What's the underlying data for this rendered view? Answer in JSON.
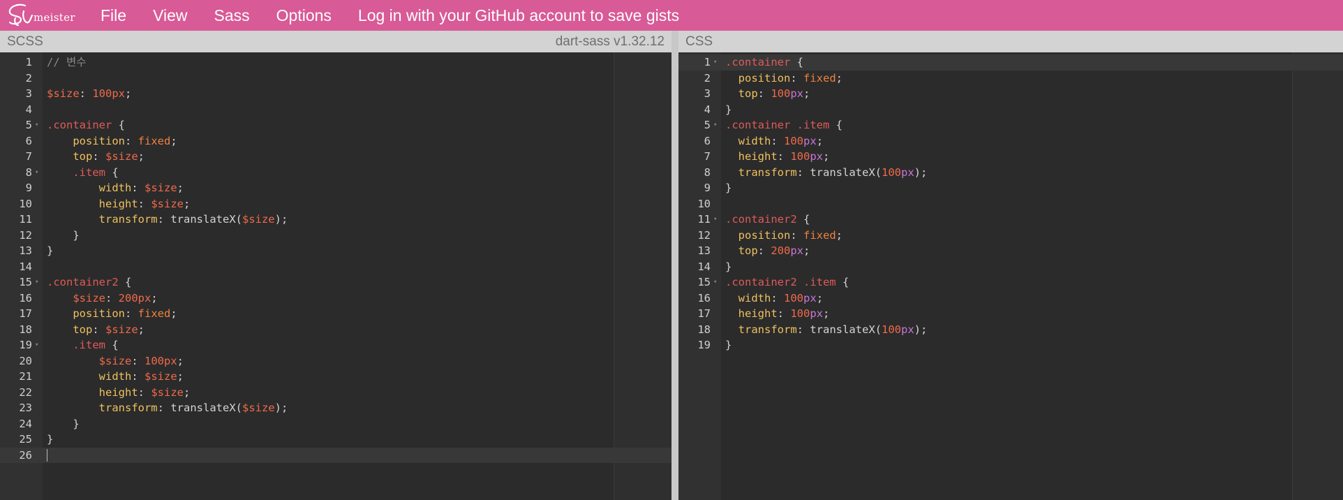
{
  "header": {
    "logo_text": "meister",
    "menu": [
      "File",
      "View",
      "Sass",
      "Options"
    ],
    "login_link": "Log in with your GitHub account to save gists"
  },
  "left_pane": {
    "title": "SCSS",
    "version": "dart-sass v1.32.12",
    "active_line": 26,
    "lines": [
      {
        "n": "1",
        "fold": false,
        "tokens": [
          {
            "t": "com",
            "v": "// 변수"
          }
        ]
      },
      {
        "n": "2",
        "fold": false,
        "tokens": []
      },
      {
        "n": "3",
        "fold": false,
        "tokens": [
          {
            "t": "var",
            "v": "$size"
          },
          {
            "t": "pun",
            "v": ": "
          },
          {
            "t": "num",
            "v": "100px"
          },
          {
            "t": "pun",
            "v": ";"
          }
        ]
      },
      {
        "n": "4",
        "fold": false,
        "tokens": []
      },
      {
        "n": "5",
        "fold": true,
        "tokens": [
          {
            "t": "sel",
            "v": ".container"
          },
          {
            "t": "pun",
            "v": " {"
          }
        ]
      },
      {
        "n": "6",
        "fold": false,
        "tokens": [
          {
            "t": "pun",
            "v": "    "
          },
          {
            "t": "prop",
            "v": "position"
          },
          {
            "t": "pun",
            "v": ": "
          },
          {
            "t": "val",
            "v": "fixed"
          },
          {
            "t": "pun",
            "v": ";"
          }
        ]
      },
      {
        "n": "7",
        "fold": false,
        "tokens": [
          {
            "t": "pun",
            "v": "    "
          },
          {
            "t": "prop",
            "v": "top"
          },
          {
            "t": "pun",
            "v": ": "
          },
          {
            "t": "var",
            "v": "$size"
          },
          {
            "t": "pun",
            "v": ";"
          }
        ]
      },
      {
        "n": "8",
        "fold": true,
        "tokens": [
          {
            "t": "pun",
            "v": "    "
          },
          {
            "t": "sel",
            "v": ".item"
          },
          {
            "t": "pun",
            "v": " {"
          }
        ]
      },
      {
        "n": "9",
        "fold": false,
        "tokens": [
          {
            "t": "pun",
            "v": "        "
          },
          {
            "t": "prop",
            "v": "width"
          },
          {
            "t": "pun",
            "v": ": "
          },
          {
            "t": "var",
            "v": "$size"
          },
          {
            "t": "pun",
            "v": ";"
          }
        ]
      },
      {
        "n": "10",
        "fold": false,
        "tokens": [
          {
            "t": "pun",
            "v": "        "
          },
          {
            "t": "prop",
            "v": "height"
          },
          {
            "t": "pun",
            "v": ": "
          },
          {
            "t": "var",
            "v": "$size"
          },
          {
            "t": "pun",
            "v": ";"
          }
        ]
      },
      {
        "n": "11",
        "fold": false,
        "tokens": [
          {
            "t": "pun",
            "v": "        "
          },
          {
            "t": "prop",
            "v": "transform"
          },
          {
            "t": "pun",
            "v": ": "
          },
          {
            "t": "fn",
            "v": "translateX("
          },
          {
            "t": "var",
            "v": "$size"
          },
          {
            "t": "pun",
            "v": ");"
          }
        ]
      },
      {
        "n": "12",
        "fold": false,
        "tokens": [
          {
            "t": "pun",
            "v": "    }"
          }
        ]
      },
      {
        "n": "13",
        "fold": false,
        "tokens": [
          {
            "t": "pun",
            "v": "}"
          }
        ]
      },
      {
        "n": "14",
        "fold": false,
        "tokens": []
      },
      {
        "n": "15",
        "fold": true,
        "tokens": [
          {
            "t": "sel",
            "v": ".container2"
          },
          {
            "t": "pun",
            "v": " {"
          }
        ]
      },
      {
        "n": "16",
        "fold": false,
        "tokens": [
          {
            "t": "pun",
            "v": "    "
          },
          {
            "t": "var",
            "v": "$size"
          },
          {
            "t": "pun",
            "v": ": "
          },
          {
            "t": "num",
            "v": "200px"
          },
          {
            "t": "pun",
            "v": ";"
          }
        ]
      },
      {
        "n": "17",
        "fold": false,
        "tokens": [
          {
            "t": "pun",
            "v": "    "
          },
          {
            "t": "prop",
            "v": "position"
          },
          {
            "t": "pun",
            "v": ": "
          },
          {
            "t": "val",
            "v": "fixed"
          },
          {
            "t": "pun",
            "v": ";"
          }
        ]
      },
      {
        "n": "18",
        "fold": false,
        "tokens": [
          {
            "t": "pun",
            "v": "    "
          },
          {
            "t": "prop",
            "v": "top"
          },
          {
            "t": "pun",
            "v": ": "
          },
          {
            "t": "var",
            "v": "$size"
          },
          {
            "t": "pun",
            "v": ";"
          }
        ]
      },
      {
        "n": "19",
        "fold": true,
        "tokens": [
          {
            "t": "pun",
            "v": "    "
          },
          {
            "t": "sel",
            "v": ".item"
          },
          {
            "t": "pun",
            "v": " {"
          }
        ]
      },
      {
        "n": "20",
        "fold": false,
        "tokens": [
          {
            "t": "pun",
            "v": "        "
          },
          {
            "t": "var",
            "v": "$size"
          },
          {
            "t": "pun",
            "v": ": "
          },
          {
            "t": "num",
            "v": "100px"
          },
          {
            "t": "pun",
            "v": ";"
          }
        ]
      },
      {
        "n": "21",
        "fold": false,
        "tokens": [
          {
            "t": "pun",
            "v": "        "
          },
          {
            "t": "prop",
            "v": "width"
          },
          {
            "t": "pun",
            "v": ": "
          },
          {
            "t": "var",
            "v": "$size"
          },
          {
            "t": "pun",
            "v": ";"
          }
        ]
      },
      {
        "n": "22",
        "fold": false,
        "tokens": [
          {
            "t": "pun",
            "v": "        "
          },
          {
            "t": "prop",
            "v": "height"
          },
          {
            "t": "pun",
            "v": ": "
          },
          {
            "t": "var",
            "v": "$size"
          },
          {
            "t": "pun",
            "v": ";"
          }
        ]
      },
      {
        "n": "23",
        "fold": false,
        "tokens": [
          {
            "t": "pun",
            "v": "        "
          },
          {
            "t": "prop",
            "v": "transform"
          },
          {
            "t": "pun",
            "v": ": "
          },
          {
            "t": "fn",
            "v": "translateX("
          },
          {
            "t": "var",
            "v": "$size"
          },
          {
            "t": "pun",
            "v": ");"
          }
        ]
      },
      {
        "n": "24",
        "fold": false,
        "tokens": [
          {
            "t": "pun",
            "v": "    }"
          }
        ]
      },
      {
        "n": "25",
        "fold": false,
        "tokens": [
          {
            "t": "pun",
            "v": "}"
          }
        ]
      },
      {
        "n": "26",
        "fold": false,
        "tokens": []
      }
    ]
  },
  "right_pane": {
    "title": "CSS",
    "active_line": 1,
    "lines": [
      {
        "n": "1",
        "fold": true,
        "tokens": [
          {
            "t": "sel",
            "v": ".container"
          },
          {
            "t": "pun",
            "v": " {"
          }
        ]
      },
      {
        "n": "2",
        "fold": false,
        "tokens": [
          {
            "t": "pun",
            "v": "  "
          },
          {
            "t": "prop",
            "v": "position"
          },
          {
            "t": "pun",
            "v": ": "
          },
          {
            "t": "val",
            "v": "fixed"
          },
          {
            "t": "pun",
            "v": ";"
          }
        ]
      },
      {
        "n": "3",
        "fold": false,
        "tokens": [
          {
            "t": "pun",
            "v": "  "
          },
          {
            "t": "prop",
            "v": "top"
          },
          {
            "t": "pun",
            "v": ": "
          },
          {
            "t": "num",
            "v": "100"
          },
          {
            "t": "unitc",
            "v": "px"
          },
          {
            "t": "pun",
            "v": ";"
          }
        ]
      },
      {
        "n": "4",
        "fold": false,
        "tokens": [
          {
            "t": "pun",
            "v": "}"
          }
        ]
      },
      {
        "n": "5",
        "fold": true,
        "tokens": [
          {
            "t": "sel",
            "v": ".container .item"
          },
          {
            "t": "pun",
            "v": " {"
          }
        ]
      },
      {
        "n": "6",
        "fold": false,
        "tokens": [
          {
            "t": "pun",
            "v": "  "
          },
          {
            "t": "prop",
            "v": "width"
          },
          {
            "t": "pun",
            "v": ": "
          },
          {
            "t": "num",
            "v": "100"
          },
          {
            "t": "unitc",
            "v": "px"
          },
          {
            "t": "pun",
            "v": ";"
          }
        ]
      },
      {
        "n": "7",
        "fold": false,
        "tokens": [
          {
            "t": "pun",
            "v": "  "
          },
          {
            "t": "prop",
            "v": "height"
          },
          {
            "t": "pun",
            "v": ": "
          },
          {
            "t": "num",
            "v": "100"
          },
          {
            "t": "unitc",
            "v": "px"
          },
          {
            "t": "pun",
            "v": ";"
          }
        ]
      },
      {
        "n": "8",
        "fold": false,
        "tokens": [
          {
            "t": "pun",
            "v": "  "
          },
          {
            "t": "prop",
            "v": "transform"
          },
          {
            "t": "pun",
            "v": ": "
          },
          {
            "t": "fn",
            "v": "translateX("
          },
          {
            "t": "num",
            "v": "100"
          },
          {
            "t": "unitc",
            "v": "px"
          },
          {
            "t": "pun",
            "v": ");"
          }
        ]
      },
      {
        "n": "9",
        "fold": false,
        "tokens": [
          {
            "t": "pun",
            "v": "}"
          }
        ]
      },
      {
        "n": "10",
        "fold": false,
        "tokens": []
      },
      {
        "n": "11",
        "fold": true,
        "tokens": [
          {
            "t": "sel",
            "v": ".container2"
          },
          {
            "t": "pun",
            "v": " {"
          }
        ]
      },
      {
        "n": "12",
        "fold": false,
        "tokens": [
          {
            "t": "pun",
            "v": "  "
          },
          {
            "t": "prop",
            "v": "position"
          },
          {
            "t": "pun",
            "v": ": "
          },
          {
            "t": "val",
            "v": "fixed"
          },
          {
            "t": "pun",
            "v": ";"
          }
        ]
      },
      {
        "n": "13",
        "fold": false,
        "tokens": [
          {
            "t": "pun",
            "v": "  "
          },
          {
            "t": "prop",
            "v": "top"
          },
          {
            "t": "pun",
            "v": ": "
          },
          {
            "t": "num",
            "v": "200"
          },
          {
            "t": "unitc",
            "v": "px"
          },
          {
            "t": "pun",
            "v": ";"
          }
        ]
      },
      {
        "n": "14",
        "fold": false,
        "tokens": [
          {
            "t": "pun",
            "v": "}"
          }
        ]
      },
      {
        "n": "15",
        "fold": true,
        "tokens": [
          {
            "t": "sel",
            "v": ".container2 .item"
          },
          {
            "t": "pun",
            "v": " {"
          }
        ]
      },
      {
        "n": "16",
        "fold": false,
        "tokens": [
          {
            "t": "pun",
            "v": "  "
          },
          {
            "t": "prop",
            "v": "width"
          },
          {
            "t": "pun",
            "v": ": "
          },
          {
            "t": "num",
            "v": "100"
          },
          {
            "t": "unitc",
            "v": "px"
          },
          {
            "t": "pun",
            "v": ";"
          }
        ]
      },
      {
        "n": "17",
        "fold": false,
        "tokens": [
          {
            "t": "pun",
            "v": "  "
          },
          {
            "t": "prop",
            "v": "height"
          },
          {
            "t": "pun",
            "v": ": "
          },
          {
            "t": "num",
            "v": "100"
          },
          {
            "t": "unitc",
            "v": "px"
          },
          {
            "t": "pun",
            "v": ";"
          }
        ]
      },
      {
        "n": "18",
        "fold": false,
        "tokens": [
          {
            "t": "pun",
            "v": "  "
          },
          {
            "t": "prop",
            "v": "transform"
          },
          {
            "t": "pun",
            "v": ": "
          },
          {
            "t": "fn",
            "v": "translateX("
          },
          {
            "t": "num",
            "v": "100"
          },
          {
            "t": "unitc",
            "v": "px"
          },
          {
            "t": "pun",
            "v": ");"
          }
        ]
      },
      {
        "n": "19",
        "fold": false,
        "tokens": [
          {
            "t": "pun",
            "v": "}"
          }
        ]
      }
    ]
  },
  "colors": {
    "header_bg": "#d85a96",
    "pane_header_bg": "#d3d3d3",
    "editor_bg": "#2b2b2b",
    "gutter_bg": "#313131"
  }
}
